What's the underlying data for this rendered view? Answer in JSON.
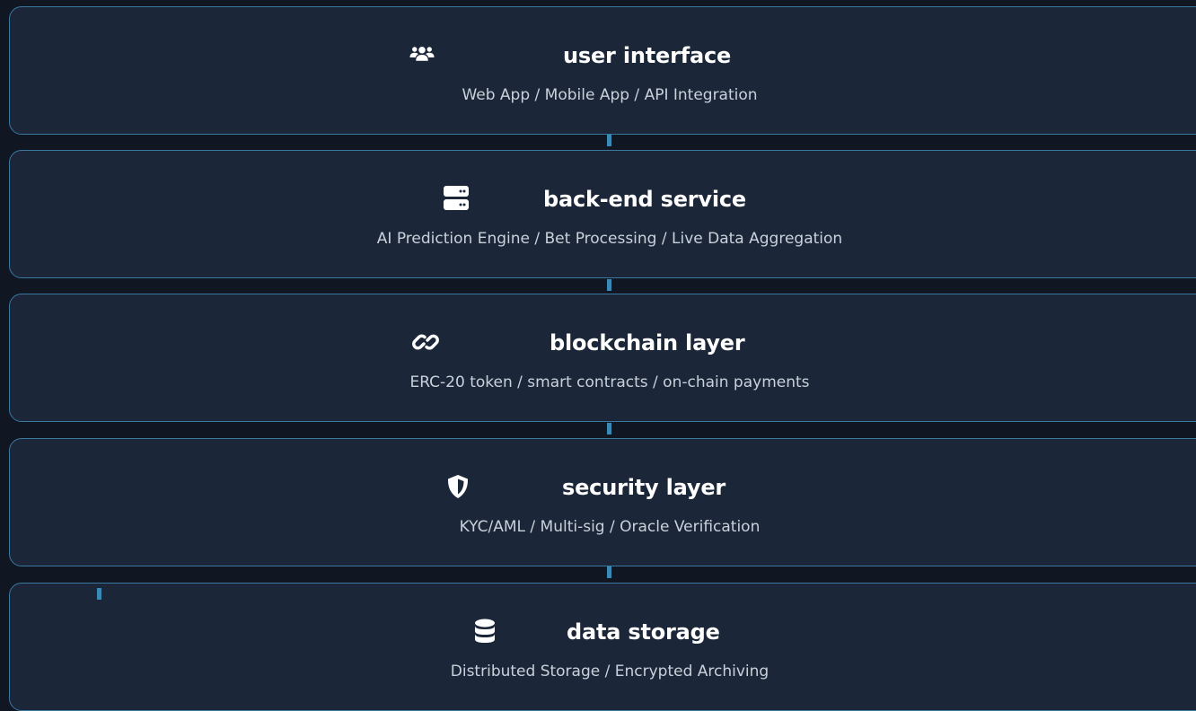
{
  "layers": [
    {
      "title": "user interface",
      "subtitle": "Web App / Mobile App / API Integration",
      "icon": "users-icon"
    },
    {
      "title": "back-end service",
      "subtitle": "AI Prediction Engine / Bet Processing / Live Data Aggregation",
      "icon": "server-icon"
    },
    {
      "title": "blockchain layer",
      "subtitle": "ERC-20 token / smart contracts / on-chain payments",
      "icon": "link-icon"
    },
    {
      "title": "security layer",
      "subtitle": "KYC/AML / Multi-sig / Oracle Verification",
      "icon": "shield-icon"
    },
    {
      "title": "data storage",
      "subtitle": "Distributed Storage / Encrypted Archiving",
      "icon": "database-icon"
    }
  ],
  "colors": {
    "background": "#111623",
    "layer_fill": "#1b2638",
    "layer_border": "#3a78a0",
    "connector": "#3a8ab8",
    "title": "#ffffff",
    "subtitle": "#c9d1da"
  }
}
